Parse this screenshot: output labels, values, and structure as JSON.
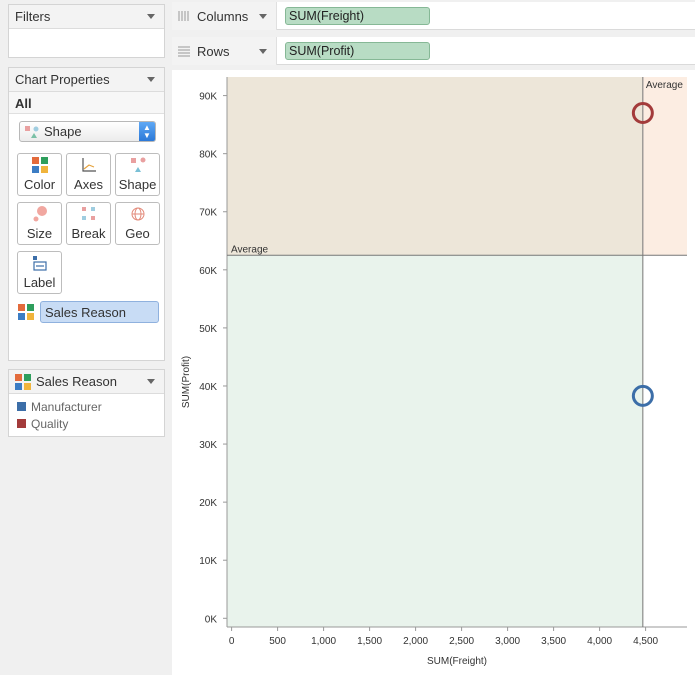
{
  "filters": {
    "title": "Filters"
  },
  "chart_properties": {
    "title": "Chart Properties",
    "all_label": "All",
    "mark_type": "Shape",
    "buttons": {
      "color": "Color",
      "axes": "Axes",
      "shape": "Shape",
      "size": "Size",
      "break": "Break",
      "geo": "Geo",
      "label": "Label"
    },
    "color_field": "Sales Reason"
  },
  "legend": {
    "title": "Sales Reason",
    "items": [
      {
        "label": "Manufacturer",
        "color": "#3c6ea8"
      },
      {
        "label": "Quality",
        "color": "#a33b3b"
      }
    ]
  },
  "shelves": {
    "columns": {
      "label": "Columns",
      "pill": "SUM(Freight)"
    },
    "rows": {
      "label": "Rows",
      "pill": "SUM(Profit)"
    }
  },
  "chart_data": {
    "type": "scatter",
    "xlabel": "SUM(Freight)",
    "ylabel": "SUM(Profit)",
    "xlim": [
      -50,
      4950
    ],
    "ylim": [
      -1500,
      93200
    ],
    "x_ticks": [
      0,
      500,
      1000,
      1500,
      2000,
      2500,
      3000,
      3500,
      4000,
      4500
    ],
    "x_tick_labels": [
      "0",
      "500",
      "1,000",
      "1,500",
      "2,000",
      "2,500",
      "3,000",
      "3,500",
      "4,000",
      "4,500"
    ],
    "y_ticks": [
      0,
      10000,
      20000,
      30000,
      40000,
      50000,
      60000,
      70000,
      80000,
      90000
    ],
    "y_tick_labels": [
      "0K",
      "10K",
      "20K",
      "30K",
      "40K",
      "50K",
      "60K",
      "70K",
      "80K",
      "90K"
    ],
    "reference_lines": {
      "x": {
        "value": 4470,
        "label": "Average"
      },
      "y": {
        "value": 62500,
        "label": "Average"
      }
    },
    "quadrant_colors": {
      "top_left": "#ede6d9",
      "top_right": "#fcede2",
      "bottom_left": "#e9f3ec",
      "bottom_right": "#ffffff"
    },
    "series": [
      {
        "name": "Manufacturer",
        "color": "#3c6ea8",
        "x": [
          4470
        ],
        "y": [
          38300
        ]
      },
      {
        "name": "Quality",
        "color": "#a33b3b",
        "x": [
          4470
        ],
        "y": [
          87000
        ]
      }
    ]
  }
}
